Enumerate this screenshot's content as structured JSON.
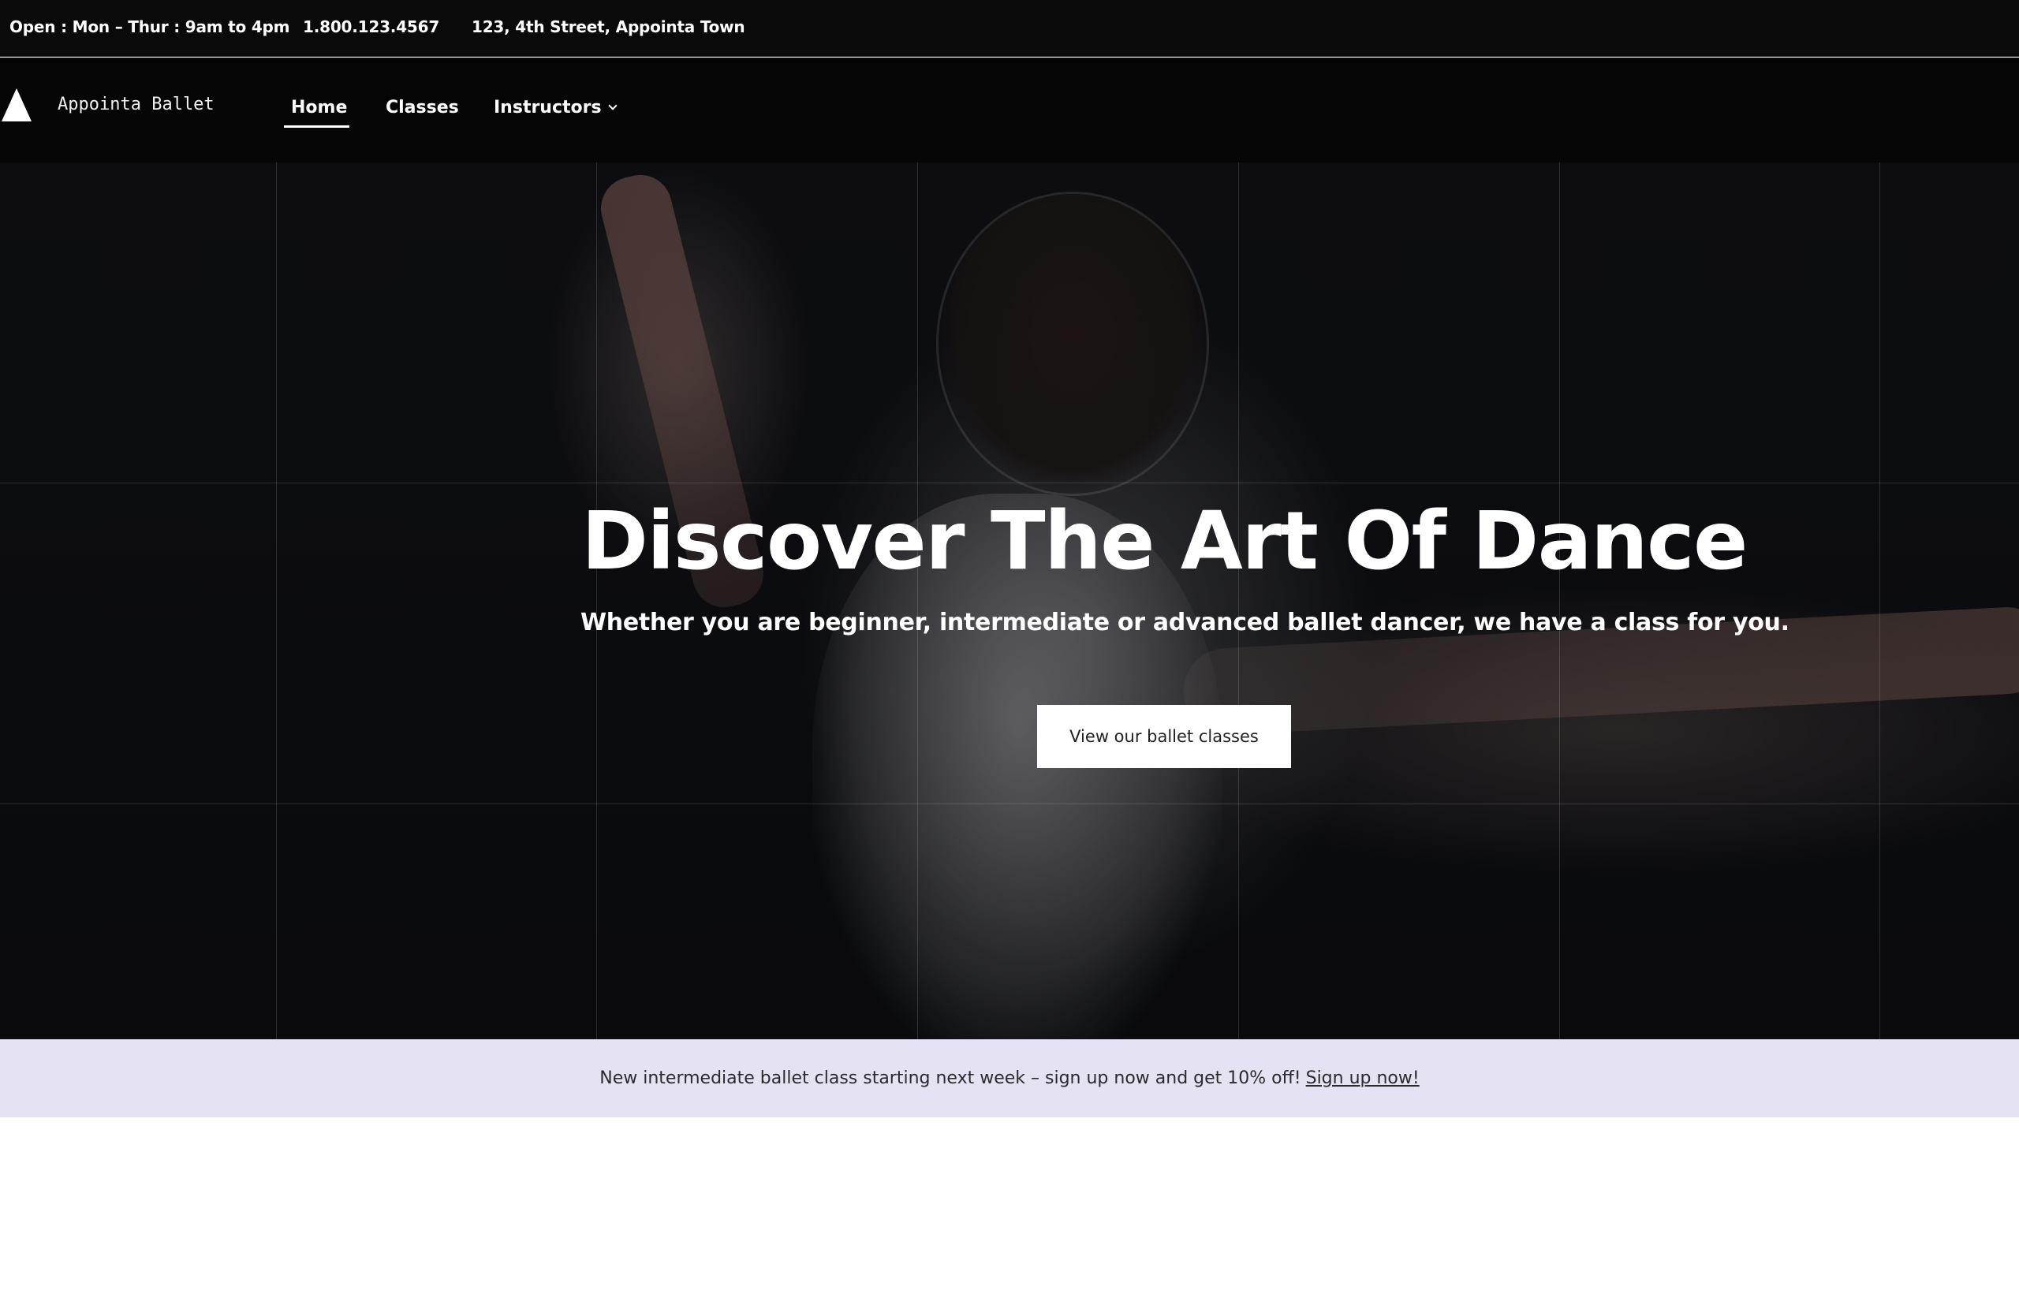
{
  "topbar": {
    "hours": "Open : Mon – Thur : 9am to 4pm",
    "phone": "1.800.123.4567",
    "address": "123, 4th Street, Appointa Town"
  },
  "header": {
    "logo_icon": "triangle-logo-icon",
    "brand": "Appointa Ballet",
    "nav": {
      "home": "Home",
      "classes": "Classes",
      "instructors": "Instructors"
    },
    "active_item": "Home"
  },
  "hero": {
    "title": "Discover The Art Of Dance",
    "subtitle": "Whether you are beginner, intermediate or advanced ballet dancer, we have a class for you.",
    "cta": "View our ballet classes"
  },
  "announcement": {
    "text": "New intermediate ballet class starting next week – sign up now and get 10% off!",
    "link": "Sign up now!"
  },
  "colors": {
    "topbar_bg": "#0a0a0a",
    "header_bg": "#050505",
    "announcement_bg": "#e5e2f4",
    "button_bg": "#ffffff"
  }
}
